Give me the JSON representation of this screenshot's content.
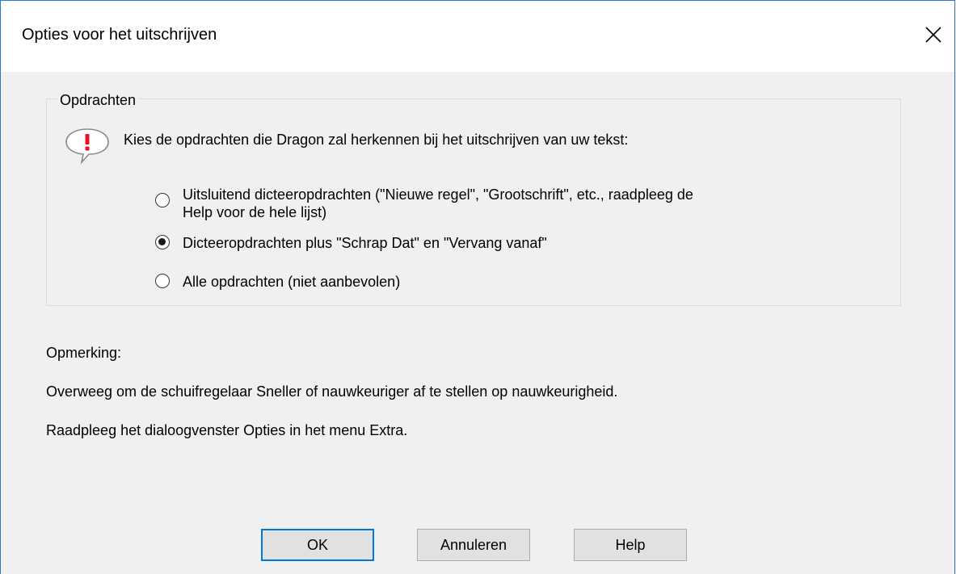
{
  "window": {
    "title": "Opties voor het uitschrijven"
  },
  "group": {
    "legend": "Opdrachten",
    "prompt": "Kies de opdrachten die Dragon zal herkennen bij het uitschrijven van uw tekst:",
    "icon": "info-balloon-icon",
    "options": [
      {
        "label_line1": "Uitsluitend dicteeropdrachten (\"Nieuwe regel\", \"Grootschrift\", etc., raadpleeg de",
        "label_line2": "Help voor de hele lijst)",
        "selected": false
      },
      {
        "label": "Dicteeropdrachten plus \"Schrap Dat\" en \"Vervang vanaf\"",
        "selected": true
      },
      {
        "label": "Alle opdrachten (niet aanbevolen)",
        "selected": false
      }
    ]
  },
  "notes": {
    "heading": "Opmerking:",
    "line1": "Overweeg om de schuifregelaar Sneller of nauwkeuriger af te stellen op nauwkeurigheid.",
    "line2": "Raadpleeg het dialoogvenster Opties in het menu Extra."
  },
  "buttons": {
    "ok": "OK",
    "cancel": "Annuleren",
    "help": "Help"
  },
  "colors": {
    "accent": "#0078d7",
    "icon_red": "#e81123"
  }
}
